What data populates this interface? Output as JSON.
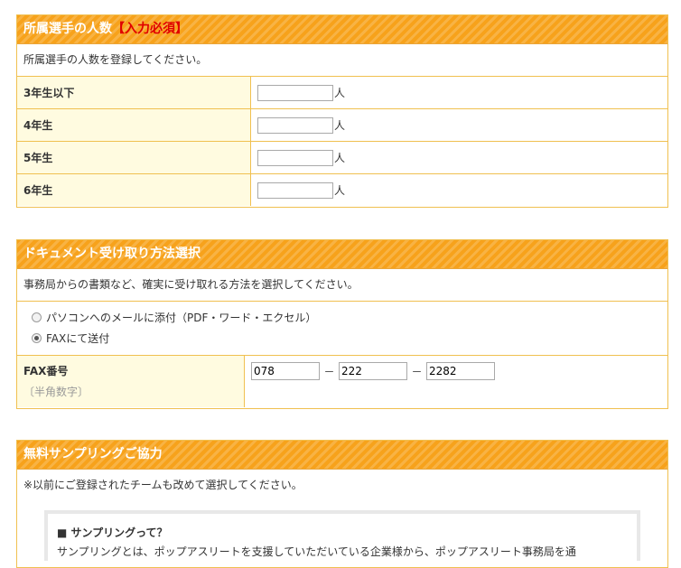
{
  "players_section": {
    "title": "所属選手の人数",
    "required_badge": "【入力必須】",
    "description": "所属選手の人数を登録してください。",
    "rows": [
      {
        "label": "3年生以下",
        "value": "",
        "unit": "人"
      },
      {
        "label": "4年生",
        "value": "",
        "unit": "人"
      },
      {
        "label": "5年生",
        "value": "",
        "unit": "人"
      },
      {
        "label": "6年生",
        "value": "",
        "unit": "人"
      }
    ]
  },
  "document_section": {
    "title": "ドキュメント受け取り方法選択",
    "description": "事務局からの書類など、確実に受け取れる方法を選択してください。",
    "options": [
      {
        "label": "パソコンへのメールに添付（PDF・ワード・エクセル）",
        "selected": false
      },
      {
        "label": "FAXにて送付",
        "selected": true
      }
    ],
    "fax": {
      "label": "FAX番号",
      "note": "〔半角数字〕",
      "part1": "078",
      "part2": "222",
      "part3": "2282",
      "separator": "－"
    }
  },
  "sampling_section": {
    "title": "無料サンプリングご協力",
    "description": "※以前にご登録されたチームも改めて選択してください。",
    "box_title": "■ サンプリングって？",
    "box_text": "サンプリングとは、ポップアスリートを支援していただいている企業様から、ポップアスリート事務局を通"
  },
  "colors": {
    "header_orange": "#f7a21b",
    "border": "#f0c050",
    "label_bg": "#fffbe0",
    "required_red": "#e00000"
  }
}
